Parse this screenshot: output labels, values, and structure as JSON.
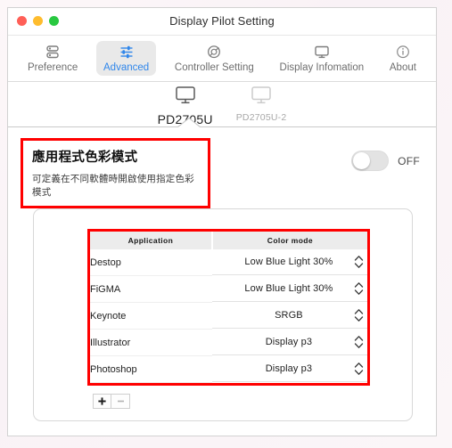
{
  "window": {
    "title": "Display Pilot Setting",
    "traffic_lights": [
      {
        "name": "close",
        "color": "#ff5f57"
      },
      {
        "name": "minimize",
        "color": "#febc2e"
      },
      {
        "name": "maximize",
        "color": "#28c840"
      }
    ]
  },
  "toolbar": {
    "items": [
      {
        "label": "Preference",
        "icon": "layers-icon",
        "active": false
      },
      {
        "label": "Advanced",
        "icon": "sliders-icon",
        "active": true
      },
      {
        "label": "Controller Setting",
        "icon": "aperture-icon",
        "active": false
      },
      {
        "label": "Display Infomation",
        "icon": "monitor-icon",
        "active": false
      },
      {
        "label": "About",
        "icon": "info-icon",
        "active": false
      }
    ],
    "active_color": "#2f86ea",
    "active_bg": "#e9e9e9"
  },
  "monitors": {
    "tabs": [
      {
        "label": "PD2705U",
        "icon": "monitor-icon",
        "active": true
      },
      {
        "label": "PD2705U-2",
        "icon": "monitor-icon",
        "active": false
      }
    ]
  },
  "section": {
    "title": "應用程式色彩模式",
    "subtitle": "可定義在不同軟體時開啟使用指定色彩模式",
    "highlight_color": "#ff0000",
    "toggle": {
      "state_label": "OFF",
      "on": false
    }
  },
  "table": {
    "headers": [
      "Application",
      "Color mode"
    ],
    "rows": [
      {
        "application": "Destop",
        "color_mode": "Low Blue Light 30%"
      },
      {
        "application": "FiGMA",
        "color_mode": "Low Blue Light 30%"
      },
      {
        "application": "Keynote",
        "color_mode": "SRGB"
      },
      {
        "application": "Illustrator",
        "color_mode": "Display p3"
      },
      {
        "application": "Photoshop",
        "color_mode": "Display p3"
      }
    ],
    "add_label": "+",
    "remove_label": "−"
  }
}
